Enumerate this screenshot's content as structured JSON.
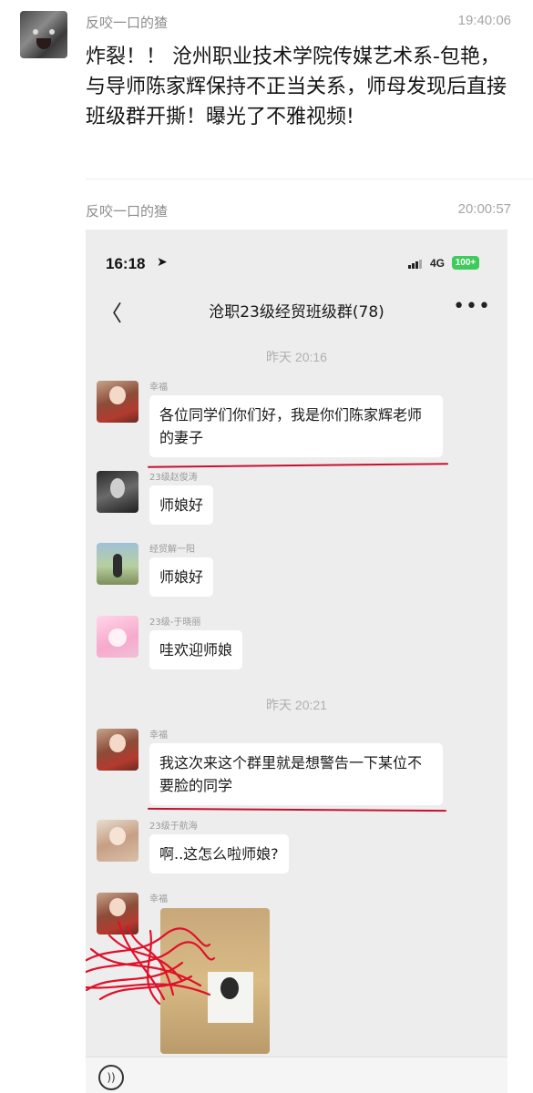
{
  "post1": {
    "sender": "反咬一口的猹",
    "time": "19:40:06",
    "text": "炸裂！！ 沧州职业技术学院传媒艺术系-包艳，与导师陈家辉保持不正当关系，师母发现后直接班级群开撕！曝光了不雅视频!"
  },
  "post2": {
    "sender": "反咬一口的猹",
    "time": "20:00:57"
  },
  "phone": {
    "status_time": "16:18",
    "location_icon": "location-arrow-icon",
    "network": "4G",
    "battery": "100+",
    "back_icon": "chevron-left-icon",
    "chat_title": "沧职23级经贸班级群(78)",
    "more_icon": "more-dots-icon",
    "more_label": "•••",
    "back_label": "〈"
  },
  "chat": {
    "timestamp1": "昨天 20:16",
    "timestamp2": "昨天 20:21",
    "messages": [
      {
        "name": "幸福",
        "text": "各位同学们你们好，我是你们陈家辉老师的妻子"
      },
      {
        "name": "23级赵俊涛",
        "text": "师娘好"
      },
      {
        "name": "经贸解一阳",
        "text": "师娘好"
      },
      {
        "name": "23级-于晓丽",
        "text": "哇欢迎师娘"
      },
      {
        "name": "幸福",
        "text": "我这次来这个群里就是想警告一下某位不要脸的同学"
      },
      {
        "name": "23级于航海",
        "text": "啊..这怎么啦师娘?"
      },
      {
        "name": "幸福",
        "text": ""
      }
    ]
  },
  "colors": {
    "annotation_red": "#c8102e",
    "battery_green": "#3ecb5c"
  },
  "input_bar": {
    "voice_icon": "voice-icon"
  }
}
